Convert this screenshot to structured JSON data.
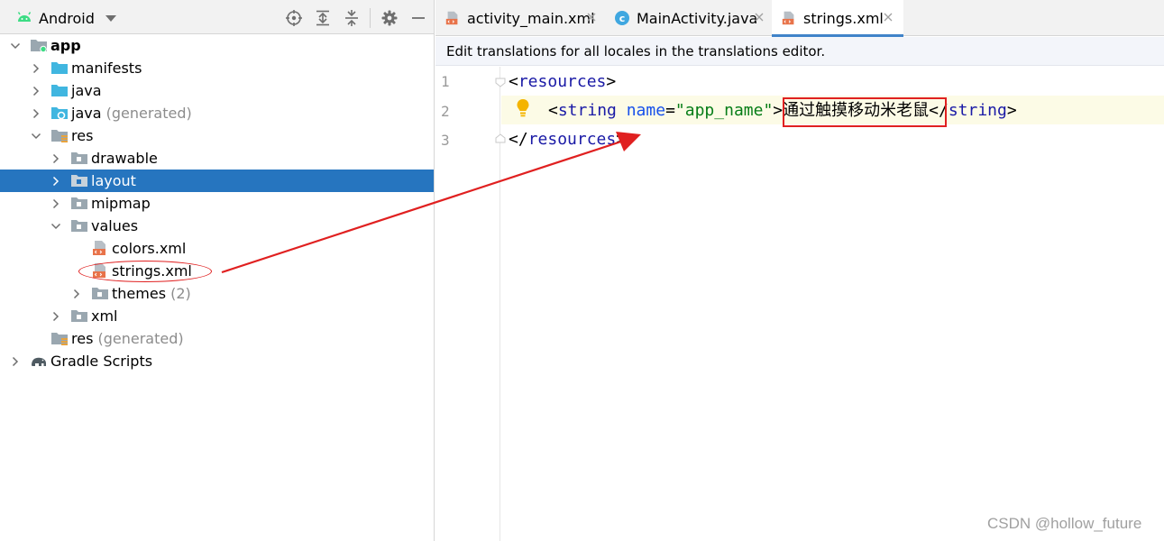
{
  "project_pane": {
    "view_selector": "Android",
    "tree": [
      {
        "label": "app",
        "bold": true
      },
      {
        "label": "manifests"
      },
      {
        "label": "java"
      },
      {
        "label": "java",
        "suffix": "(generated)"
      },
      {
        "label": "res"
      },
      {
        "label": "drawable"
      },
      {
        "label": "layout",
        "selected": true
      },
      {
        "label": "mipmap"
      },
      {
        "label": "values"
      },
      {
        "label": "colors.xml"
      },
      {
        "label": "strings.xml"
      },
      {
        "label": "themes",
        "suffix": "(2)"
      },
      {
        "label": "xml"
      },
      {
        "label": "res",
        "suffix": "(generated)"
      },
      {
        "label": "Gradle Scripts"
      }
    ]
  },
  "editor": {
    "tabs": [
      {
        "label": "activity_main.xml",
        "icon": "xml-file-icon"
      },
      {
        "label": "MainActivity.java",
        "icon": "java-class-icon"
      },
      {
        "label": "strings.xml",
        "icon": "xml-file-icon",
        "active": true
      }
    ],
    "notice": "Edit translations for all locales in the translations editor.",
    "line_numbers": [
      "1",
      "2",
      "3"
    ],
    "code": {
      "line1": {
        "open": "<",
        "tag": "resources",
        "close": ">"
      },
      "line2": {
        "open": "<",
        "tag": "string",
        "attr": "name",
        "eq": "=",
        "value": "\"app_name\"",
        "gt": ">",
        "text": "通过触摸移动米老鼠",
        "end_open": "</",
        "end_tag": "string",
        "end_close": ">"
      },
      "line3": {
        "open": "</",
        "tag": "resources",
        "close": ">"
      }
    }
  },
  "colors": {
    "selection": "#2675bf",
    "annotation_red": "#e02020",
    "xml_tag": "#1a1aa6",
    "xml_value": "#067d17"
  },
  "watermark": "CSDN @hollow_future"
}
